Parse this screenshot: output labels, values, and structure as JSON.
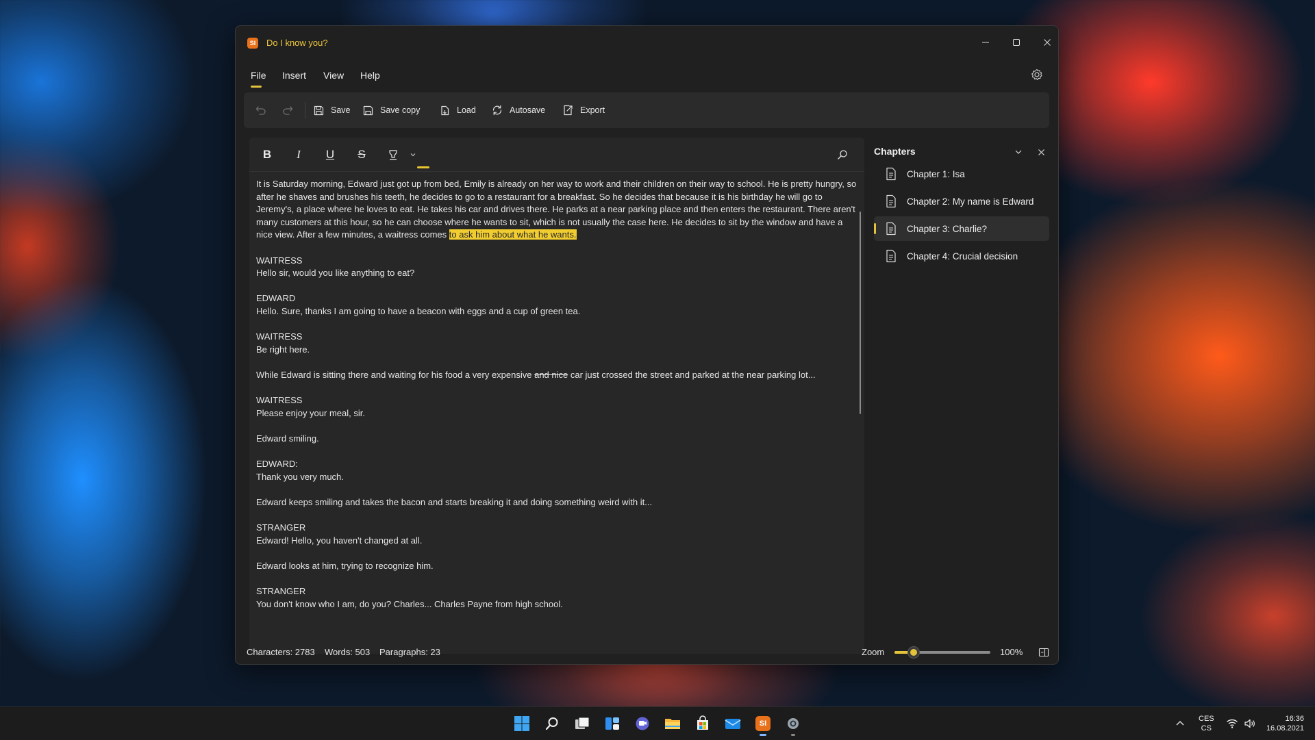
{
  "window": {
    "title": "Do I know you?",
    "app_icon": "SI"
  },
  "menu": {
    "items": [
      "File",
      "Insert",
      "View",
      "Help"
    ],
    "active": "File"
  },
  "toolbar": {
    "save": "Save",
    "save_copy": "Save copy",
    "load": "Load",
    "autosave": "Autosave",
    "export": "Export"
  },
  "format": {
    "buttons": [
      "bold",
      "italic",
      "underline",
      "strikethrough",
      "highlighter"
    ]
  },
  "document": {
    "intro_before": "It is Saturday morning, Edward just got up from bed, Emily is already on her way to work and their children on their way to school. He is pretty hungry, so after he shaves and brushes his teeth, he decides to go to a restaurant for a breakfast. So he decides that because it is his birthday he will go to Jeremy's, a place where he loves to eat. He takes his car and drives there. He parks at a near parking place and then enters the restaurant. There aren't many customers at this hour, so he can choose where he wants to sit, which is not usually the case here. He decides to sit by the window and have a nice view. After a few minutes, a waitress comes ",
    "intro_highlight": "to ask him about what he wants.",
    "p1_speaker": "WAITRESS",
    "p1_line": "Hello sir, would you like anything to eat?",
    "p2_speaker": "EDWARD",
    "p2_line": "Hello. Sure, thanks I am going to have a beacon with eggs and a cup of green tea.",
    "p3_speaker": "WAITRESS",
    "p3_line": "Be right here.",
    "p4_before": "While Edward is sitting there and waiting for his food a very expensive ",
    "p4_strike": "and nice",
    "p4_after": " car just crossed the street and parked at the near parking lot...",
    "p5_speaker": "WAITRESS",
    "p5_line": "Please enjoy your meal, sir.",
    "p6": "Edward smiling.",
    "p7_speaker": "EDWARD:",
    "p7_line": "Thank you very much.",
    "p8": "Edward keeps smiling and takes the bacon and starts breaking it and doing something weird with it...",
    "p9_speaker": "STRANGER",
    "p9_line": "Edward! Hello, you haven't changed at all.",
    "p10": "Edward looks at him, trying to recognize him.",
    "p11_speaker": "STRANGER",
    "p11_line": "You don't know who I am, do you? Charles... Charles Payne from high school."
  },
  "chapters": {
    "title": "Chapters",
    "items": [
      "Chapter 1: Isa",
      "Chapter 2: My name is Edward",
      "Chapter 3: Charlie?",
      "Chapter 4: Crucial decision"
    ],
    "selected_index": 2
  },
  "status": {
    "characters": "Characters: 2783",
    "words": "Words: 503",
    "paragraphs": "Paragraphs: 23",
    "zoom_label": "Zoom",
    "zoom_value": "100%",
    "zoom_fraction": 0.2
  },
  "taskbar": {
    "icons": [
      "windows-start-icon",
      "search-icon",
      "task-view-icon",
      "widgets-icon",
      "teams-chat-icon",
      "file-explorer-icon",
      "store-icon",
      "mail-icon",
      "app-si-icon",
      "settings-icon"
    ],
    "active_app": "app-si-icon"
  },
  "tray": {
    "lang_top": "CES",
    "lang_bottom": "CS",
    "time": "16:36",
    "date": "16.08.2021"
  },
  "colors": {
    "accent": "#e3c33a",
    "highlight": "#f2cd30",
    "window_bg": "#202020"
  }
}
